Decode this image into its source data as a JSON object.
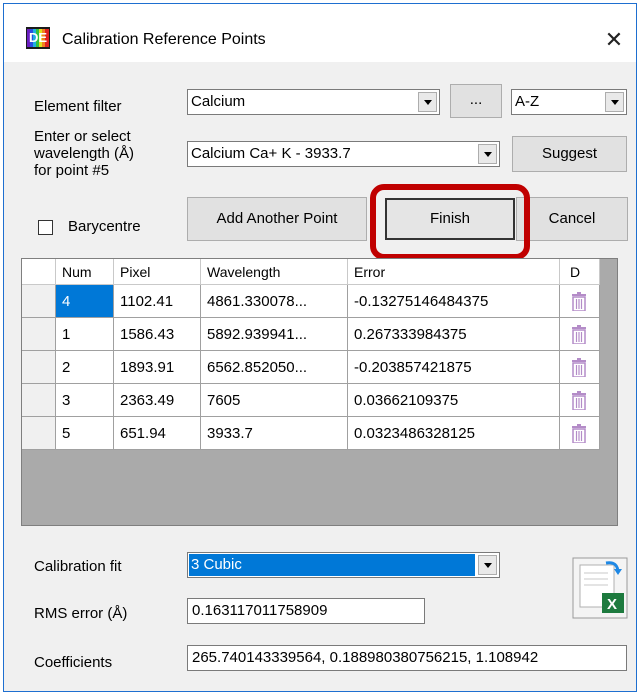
{
  "window": {
    "title": "Calibration Reference Points",
    "close_glyph": "✕"
  },
  "element_filter": {
    "label": "Element filter",
    "value": "Calcium",
    "ellipsis_button": "...",
    "sort_value": "A-Z"
  },
  "wavelength": {
    "label_line1": "Enter or select",
    "label_line2": "wavelength (Å)",
    "label_line3": "for point #5",
    "value": "Calcium Ca+ K - 3933.7",
    "suggest_button": "Suggest"
  },
  "barycentre": {
    "label": "Barycentre",
    "checked": false
  },
  "buttons": {
    "add_point": "Add Another Point",
    "finish": "Finish",
    "cancel": "Cancel"
  },
  "table": {
    "headers": {
      "num": "Num",
      "pixel": "Pixel",
      "wavelength": "Wavelength",
      "error": "Error",
      "delete": "D"
    },
    "rows": [
      {
        "num": "4",
        "pixel": "1102.41",
        "wavelength": "4861.330078...",
        "error": "-0.13275146484375",
        "selected": true
      },
      {
        "num": "1",
        "pixel": "1586.43",
        "wavelength": "5892.939941...",
        "error": "0.267333984375"
      },
      {
        "num": "2",
        "pixel": "1893.91",
        "wavelength": "6562.852050...",
        "error": "-0.203857421875"
      },
      {
        "num": "3",
        "pixel": "2363.49",
        "wavelength": "7605",
        "error": "0.03662109375"
      },
      {
        "num": "5",
        "pixel": "651.94",
        "wavelength": "3933.7",
        "error": "0.0323486328125"
      }
    ]
  },
  "fit": {
    "label": "Calibration fit",
    "value": "3 Cubic",
    "rms_label": "RMS error (Å)",
    "rms_value": "0.163117011758909",
    "coef_label": "Coefficients",
    "coef_value": "265.740143339564, 0.188980380756215, 1.108942"
  },
  "colors": {
    "selection": "#0078d7",
    "highlight": "#c00000",
    "trash": "#b48cc8"
  }
}
